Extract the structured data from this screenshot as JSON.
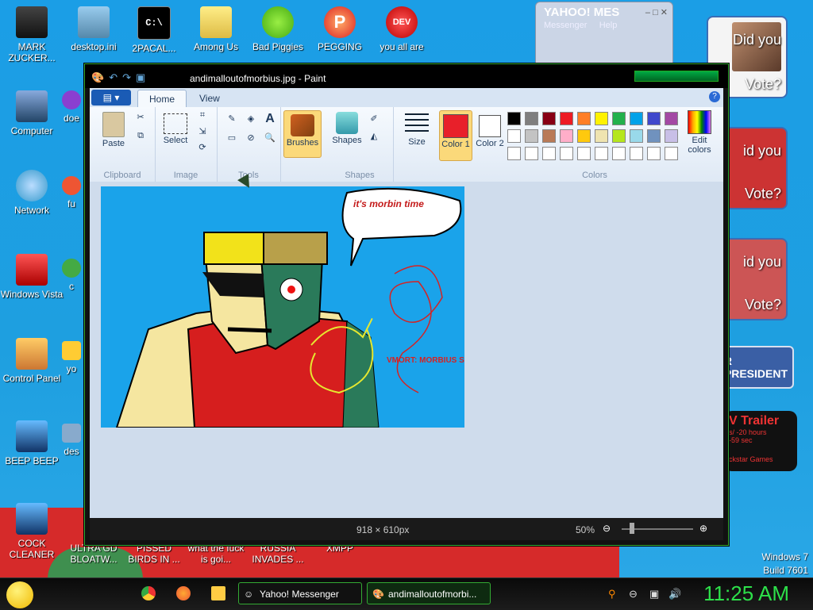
{
  "desktop": {
    "icons_left": [
      {
        "label": "MARK ZUCKER...",
        "icon": "user-folder-icon"
      },
      {
        "label": "Computer",
        "icon": "computer-icon"
      },
      {
        "label": "Network",
        "icon": "network-icon"
      },
      {
        "label": "Windows Vista",
        "icon": "recycle-bin-icon"
      },
      {
        "label": "Control Panel",
        "icon": "control-panel-icon"
      },
      {
        "label": "BEEP BEEP",
        "icon": "blue-file-icon"
      },
      {
        "label": "COCK CLEANER",
        "icon": "blue-file-icon"
      }
    ],
    "icons_top": [
      {
        "label": "desktop.ini",
        "icon": "ini-file-icon"
      },
      {
        "label": "2PACAL...",
        "icon": "cmd-icon"
      },
      {
        "label": "Among Us",
        "icon": "folder-icon"
      },
      {
        "label": "Bad Piggies",
        "icon": "bad-piggies-icon"
      },
      {
        "label": "PEGGING",
        "icon": "p-app-icon"
      },
      {
        "label": "you all are",
        "icon": "devcpp-icon"
      }
    ],
    "icons_partial": [
      {
        "label": "doe"
      },
      {
        "label": "fu"
      },
      {
        "label": "c"
      },
      {
        "label": "yo"
      },
      {
        "label": "des"
      }
    ],
    "icons_bottom": [
      {
        "label": "ULTRA GD BLOATW..."
      },
      {
        "label": "PISSED BIRDS IN ..."
      },
      {
        "label": "what the fuck is goi..."
      },
      {
        "label": "RUSSIA INVADES ..."
      },
      {
        "label": "XMPP"
      }
    ],
    "windows_version": "Windows 7",
    "build": "Build 7601"
  },
  "yahoo_window": {
    "title": "YAHOO! MES",
    "menu": [
      "Messenger",
      "Help"
    ]
  },
  "ads": {
    "did_you": "Did you",
    "vote": "Vote?",
    "id_you": "id you",
    "vote2": "Vote?",
    "president": "R PRESIDENT",
    "trailer": "V Trailer",
    "trailer_l1": "s/ -20 hours",
    "trailer_l2": "-59 sec",
    "trailer_l3": "ckstar Games"
  },
  "paint": {
    "title": "andimalloutofmorbius.jpg - Paint",
    "tabs": [
      {
        "label": "Home",
        "active": true
      },
      {
        "label": "View",
        "active": false
      }
    ],
    "groups": {
      "clipboard": "Clipboard",
      "image": "Image",
      "tools": "Tools",
      "shapes": "Shapes",
      "colors": "Colors"
    },
    "buttons": {
      "paste": "Paste",
      "select": "Select",
      "brushes": "Brushes",
      "shapes": "Shapes",
      "size": "Size",
      "color1": "Color 1",
      "color2": "Color 2",
      "edit_colors": "Edit colors"
    },
    "color1": "#e8202a",
    "color2": "#ffffff",
    "palette_row1": [
      "#000000",
      "#7f7f7f",
      "#880015",
      "#ed1c24",
      "#ff7f27",
      "#fff200",
      "#22b14c",
      "#00a2e8",
      "#3f48cc",
      "#a349a4"
    ],
    "palette_row2": [
      "#ffffff",
      "#c3c3c3",
      "#b97a57",
      "#ffaec9",
      "#ffc90e",
      "#efe4b0",
      "#b5e61d",
      "#99d9ea",
      "#7092be",
      "#c8bfe7"
    ],
    "status": {
      "dimensions": "918 × 610px",
      "zoom": "50%"
    },
    "drawing": {
      "speech": "it's morbin time",
      "red_text": "VMORT: MORBIUS SPECIAL EDITION!!!"
    }
  },
  "taskbar": {
    "items": [
      {
        "label": "Yahoo! Messenger",
        "active": false
      },
      {
        "label": "andimalloutofmorbi...",
        "active": true
      }
    ],
    "clock": "11:25 AM"
  }
}
